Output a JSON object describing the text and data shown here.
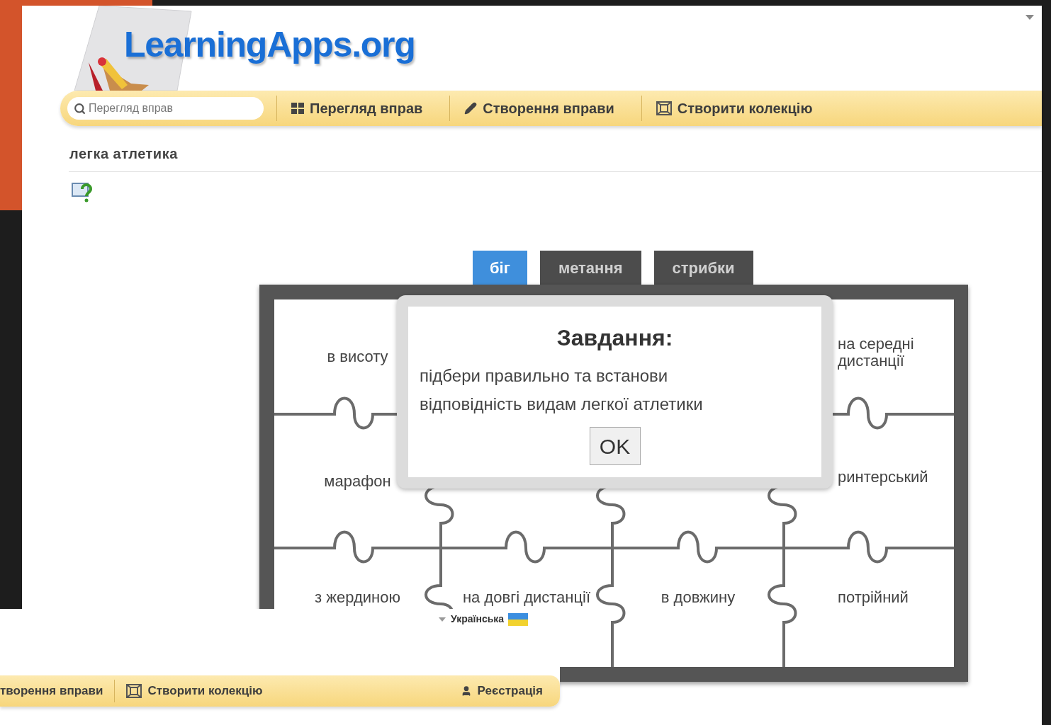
{
  "logo": {
    "text": "LearningApps.org"
  },
  "navbar": {
    "search": {
      "placeholder": "Перегляд вправ"
    },
    "items": [
      {
        "kind": "grid",
        "label": "Перегляд вправ"
      },
      {
        "kind": "pencil",
        "label": "Створення вправи"
      },
      {
        "kind": "collection",
        "label": "Створити колекцію"
      }
    ]
  },
  "page_title": "легка атлетика",
  "tabs": [
    {
      "label": "біг",
      "selected": true
    },
    {
      "label": "метання",
      "selected": false
    },
    {
      "label": "стрибки",
      "selected": false
    }
  ],
  "puzzle": {
    "rows": [
      [
        "в висоту",
        null,
        null,
        "на середні дистанції"
      ],
      [
        "марафон",
        null,
        null,
        "ринтерський"
      ],
      [
        "з жердиною",
        "на довгі дистанції",
        "в довжину",
        "потрійний"
      ]
    ]
  },
  "dialog": {
    "title": "Завдання:",
    "text": "підбери правильно та встанови відповідність видам легкої атлетики",
    "button": "OK"
  },
  "lower_screenshot": {
    "language": "Українська",
    "nav_items": [
      {
        "kind": "plain",
        "label": "творення вправи"
      },
      {
        "kind": "collection",
        "label": "Створити колекцію"
      },
      {
        "kind": "user",
        "label": "Реєстрація"
      }
    ]
  }
}
